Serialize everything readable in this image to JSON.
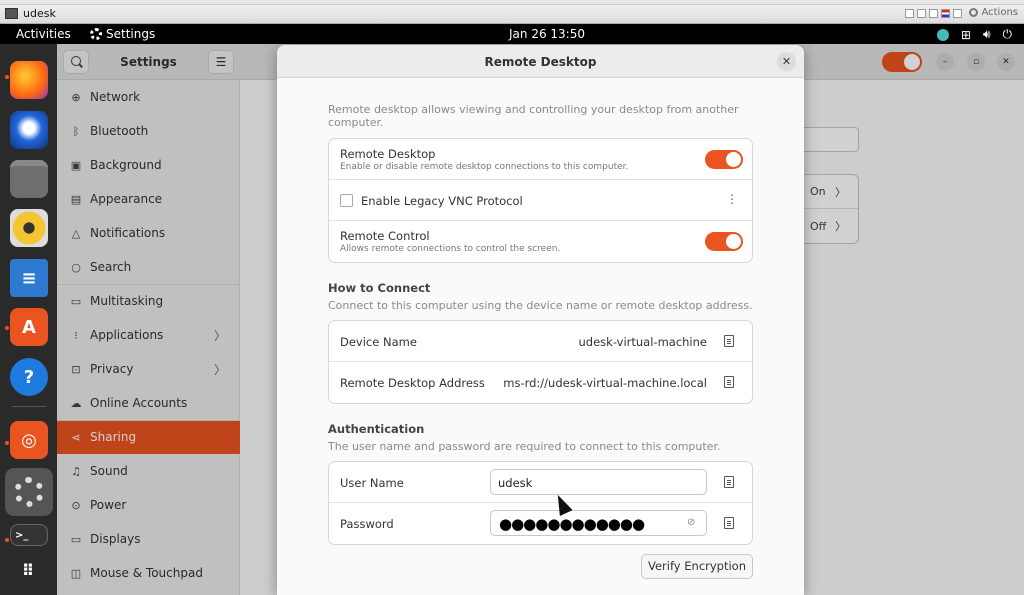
{
  "vm": {
    "title": "udesk",
    "actions_label": "Actions"
  },
  "topbar": {
    "activities": "Activities",
    "app_name": "Settings",
    "clock": "Jan 26  13:50"
  },
  "dock": {
    "items": [
      "firefox",
      "thunderbird",
      "files",
      "rhythmbox",
      "writer",
      "app-center",
      "help",
      "ubuntu",
      "settings",
      "terminal",
      "show-apps"
    ]
  },
  "sidebar": {
    "title": "Settings",
    "items": [
      {
        "label": "Network",
        "icon": "network-icon"
      },
      {
        "label": "Bluetooth",
        "icon": "bluetooth-icon"
      },
      {
        "label": "Background",
        "icon": "background-icon"
      },
      {
        "label": "Appearance",
        "icon": "appearance-icon"
      },
      {
        "label": "Notifications",
        "icon": "bell-icon"
      },
      {
        "label": "Search",
        "icon": "search-icon"
      },
      {
        "label": "Multitasking",
        "icon": "multitasking-icon"
      },
      {
        "label": "Applications",
        "icon": "grid-icon",
        "has_chevron": true
      },
      {
        "label": "Privacy",
        "icon": "lock-icon",
        "has_chevron": true
      },
      {
        "label": "Online Accounts",
        "icon": "cloud-icon"
      },
      {
        "label": "Sharing",
        "icon": "share-icon",
        "active": true
      },
      {
        "label": "Sound",
        "icon": "music-note-icon"
      },
      {
        "label": "Power",
        "icon": "power-icon"
      },
      {
        "label": "Displays",
        "icon": "display-icon"
      },
      {
        "label": "Mouse & Touchpad",
        "icon": "mouse-icon"
      }
    ]
  },
  "background_rows": [
    {
      "value": "On"
    },
    {
      "value": "Off"
    }
  ],
  "dialog": {
    "title": "Remote Desktop",
    "description": "Remote desktop allows viewing and controlling your desktop from another computer.",
    "remote_desktop": {
      "label": "Remote Desktop",
      "sub": "Enable or disable remote desktop connections to this computer.",
      "enabled": true
    },
    "legacy_vnc": {
      "label": "Enable Legacy VNC Protocol",
      "checked": false
    },
    "remote_control": {
      "label": "Remote Control",
      "sub": "Allows remote connections to control the screen.",
      "enabled": true
    },
    "how_to_connect": {
      "title": "How to Connect",
      "desc": "Connect to this computer using the device name or remote desktop address.",
      "device_name_label": "Device Name",
      "device_name": "udesk-virtual-machine",
      "address_label": "Remote Desktop Address",
      "address": "ms-rd://udesk-virtual-machine.local"
    },
    "authentication": {
      "title": "Authentication",
      "desc": "The user name and password are required to connect to this computer.",
      "username_label": "User Name",
      "username": "udesk",
      "password_label": "Password",
      "password_mask": "●●●●●●●●●●●●"
    },
    "verify_button": "Verify Encryption"
  },
  "colors": {
    "accent": "#e95420",
    "dock_bg": "#2a2a2a",
    "topbar_bg": "#000000"
  }
}
